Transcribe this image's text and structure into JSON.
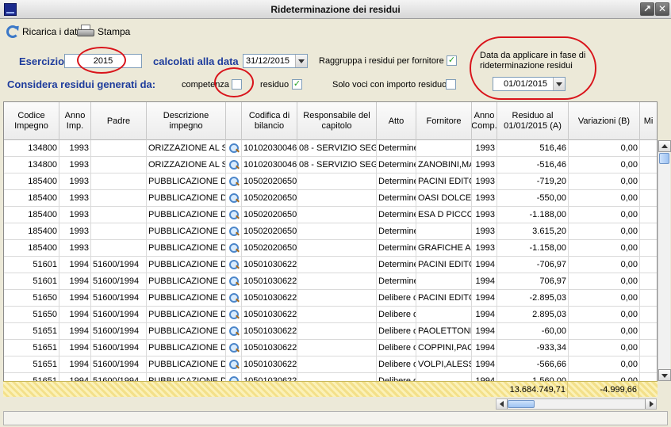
{
  "window": {
    "title": "Rideterminazione dei residui"
  },
  "toolbar": {
    "reload_label": "Ricarica i dati",
    "print_label": "Stampa"
  },
  "filters": {
    "esercizio_label": "Esercizio",
    "esercizio_value": "2015",
    "calcolati_label": "calcolati alla data",
    "calcolati_value": "31/12/2015",
    "raggruppa_label": "Raggruppa i residui per fornitore",
    "raggruppa_checked": true,
    "considera_label": "Considera residui generati da:",
    "competenza_label": "competenza",
    "competenza_checked": false,
    "residuo_label": "residuo",
    "residuo_checked": true,
    "solo_voci_label": "Solo voci con importo residuo",
    "solo_voci_checked": false,
    "data_applicare_label": "Data da applicare in fase di rideterminazione residui",
    "data_applicare_value": "01/01/2015"
  },
  "grid": {
    "columns": [
      "Codice Impegno",
      "Anno Imp.",
      "Padre",
      "Descrizione impegno",
      "",
      "Codifica di bilancio",
      "Responsabile del capitolo",
      "Atto",
      "Fornitore",
      "Anno Comp.",
      "Residuo al 01/01/2015 (A)",
      "Variazioni (B)",
      "Mi"
    ],
    "rows": [
      [
        "134800",
        "1993",
        "",
        "ORIZZAZIONE AL SI",
        "",
        "10102030046",
        "08 - SERVIZIO SEGR",
        "Determine",
        "",
        "1993",
        "516,46",
        "0,00"
      ],
      [
        "134800",
        "1993",
        "",
        "ORIZZAZIONE AL SI",
        "",
        "10102030046",
        "08 - SERVIZIO SEGR",
        "Determine",
        "ZANOBINI,MA",
        "1993",
        "-516,46",
        "0,00"
      ],
      [
        "185400",
        "1993",
        "",
        "PUBBLICAZIONE DEI",
        "",
        "10502020650",
        "",
        "Determine",
        "PACINI EDITC",
        "1993",
        "-719,20",
        "0,00"
      ],
      [
        "185400",
        "1993",
        "",
        "PUBBLICAZIONE DEI",
        "",
        "10502020650",
        "",
        "Determine",
        "OASI DOLCE F",
        "1993",
        "-550,00",
        "0,00"
      ],
      [
        "185400",
        "1993",
        "",
        "PUBBLICAZIONE DEI",
        "",
        "10502020650",
        "",
        "Determine",
        "ESA D PICCOL",
        "1993",
        "-1.188,00",
        "0,00"
      ],
      [
        "185400",
        "1993",
        "",
        "PUBBLICAZIONE DEI",
        "",
        "10502020650",
        "",
        "Determine",
        "",
        "1993",
        "3.615,20",
        "0,00"
      ],
      [
        "185400",
        "1993",
        "",
        "PUBBLICAZIONE DEI",
        "",
        "10502020650",
        "",
        "Determine",
        "GRAFICHE AL",
        "1993",
        "-1.158,00",
        "0,00"
      ],
      [
        "51601",
        "1994",
        "51600/1994",
        "PUBBLICAZIONE DEI",
        "",
        "10501030622",
        "",
        "Determine",
        "PACINI EDITC",
        "1994",
        "-706,97",
        "0,00"
      ],
      [
        "51601",
        "1994",
        "51600/1994",
        "PUBBLICAZIONE DEI",
        "",
        "10501030622",
        "",
        "Determine",
        "",
        "1994",
        "706,97",
        "0,00"
      ],
      [
        "51650",
        "1994",
        "51600/1994",
        "PUBBLICAZIONE DEI",
        "",
        "10501030622",
        "",
        "Delibere d",
        "PACINI EDITC",
        "1994",
        "-2.895,03",
        "0,00"
      ],
      [
        "51650",
        "1994",
        "51600/1994",
        "PUBBLICAZIONE DEI",
        "",
        "10501030622",
        "",
        "Delibere d",
        "",
        "1994",
        "2.895,03",
        "0,00"
      ],
      [
        "51651",
        "1994",
        "51600/1994",
        "PUBBLICAZIONE DEI",
        "",
        "10501030622",
        "",
        "Delibere d",
        "PAOLETTONI",
        "1994",
        "-60,00",
        "0,00"
      ],
      [
        "51651",
        "1994",
        "51600/1994",
        "PUBBLICAZIONE DEI",
        "",
        "10501030622",
        "",
        "Delibere d",
        "COPPINI,PAO",
        "1994",
        "-933,34",
        "0,00"
      ],
      [
        "51651",
        "1994",
        "51600/1994",
        "PUBBLICAZIONE DEI",
        "",
        "10501030622",
        "",
        "Delibere d",
        "VOLPI,ALESSA",
        "1994",
        "-566,66",
        "0,00"
      ],
      [
        "51651",
        "1994",
        "51600/1994",
        "PUBBLICAZIONE DEI",
        "",
        "10501030622",
        "",
        "Delibere d",
        "",
        "1994",
        "1.560,00",
        "0,00"
      ]
    ],
    "totals": {
      "residuo": "13.684.749,71",
      "variazioni": "-4.999,66"
    }
  },
  "colors": {
    "label_blue": "#1e3c9c",
    "annotation_red": "#d9141b",
    "totals_yellow": "#f3e08a"
  }
}
